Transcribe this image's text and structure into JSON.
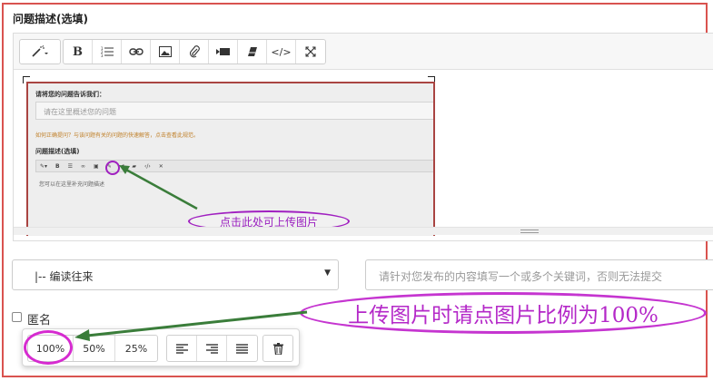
{
  "form": {
    "description_label": "问题描述(选填)",
    "category_select": "|-- 编读往来",
    "keywords_placeholder": "请针对您发布的内容填写一个或多个关键词，否则无法提交",
    "anonymous_label": "匿名"
  },
  "toolbar": {
    "items": [
      "magic-wand",
      "bold",
      "ordered-list",
      "link",
      "image",
      "attachment",
      "video",
      "eraser",
      "code",
      "fullscreen"
    ],
    "bold_label": "B",
    "code_label": "</>"
  },
  "embedded": {
    "title": "请将您的问题告诉我们：",
    "input_placeholder": "请在这里概述您的问题",
    "warning": "如何正确提问？与该问题有关的问题的快速解答，点击查看此规范。",
    "section": "问题描述(选填)",
    "body": "您可以在这里补充问题描述",
    "hint": "点击此处可上传图片"
  },
  "image_popover": {
    "size_100": "100%",
    "size_50": "50%",
    "size_25": "25%"
  },
  "annotation": {
    "text": "上传图片时请点图片比例为100%"
  },
  "colors": {
    "frame_red": "#d9534f",
    "annotation_purple": "#c535d0",
    "arrow_green": "#3a7d3a"
  }
}
